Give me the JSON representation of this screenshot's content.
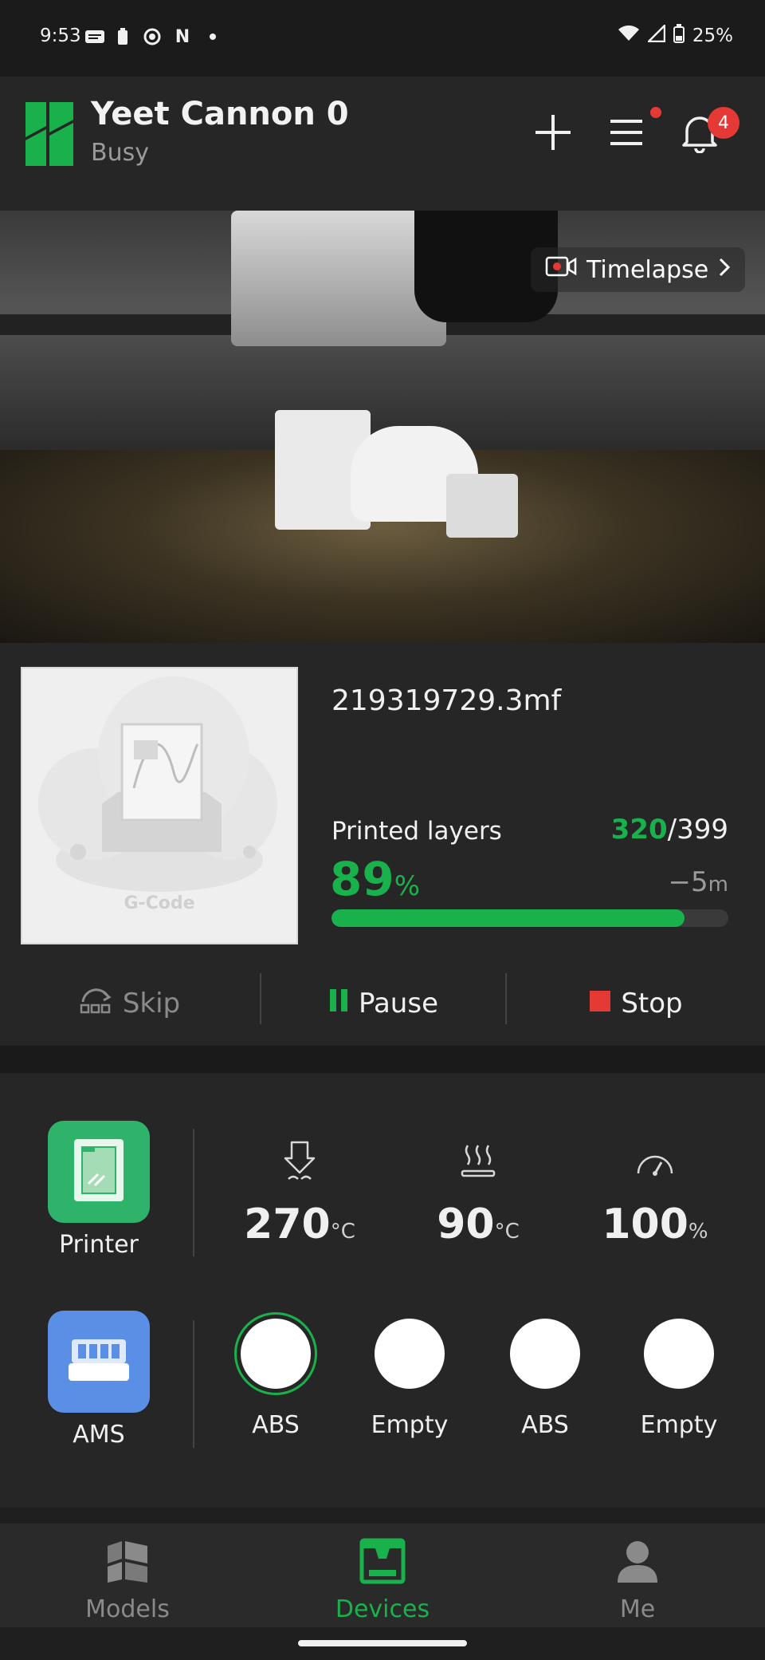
{
  "status_bar": {
    "time": "9:53",
    "battery": "25%"
  },
  "header": {
    "title": "Yeet Cannon 0",
    "subtitle": "Busy",
    "notification_count": "4"
  },
  "camera": {
    "timelapse_label": "Timelapse"
  },
  "print": {
    "filename": "219319729.3mf",
    "thumbnail_label": "G-Code",
    "layers_label": "Printed layers",
    "layers_current": "320",
    "layers_total": "/399",
    "progress_value": "89",
    "progress_unit": "%",
    "progress_fraction": 0.89,
    "remaining_value": "−5",
    "remaining_unit": "m",
    "controls": {
      "skip": "Skip",
      "pause": "Pause",
      "stop": "Stop"
    }
  },
  "device": {
    "printer_label": "Printer",
    "nozzle_temp": "270",
    "nozzle_unit": "°C",
    "bed_temp": "90",
    "bed_unit": "°C",
    "speed": "100",
    "speed_unit": "%",
    "ams_label": "AMS",
    "slots": [
      "ABS",
      "Empty",
      "ABS",
      "Empty"
    ]
  },
  "bottom_nav": {
    "models": "Models",
    "devices": "Devices",
    "me": "Me"
  },
  "colors": {
    "accent": "#19b14b",
    "danger": "#e53935",
    "ams_tile": "#5b8fe6",
    "printer_tile": "#2fb36a"
  },
  "icons": [
    "wifi-icon",
    "signal-icon",
    "battery-icon",
    "plus-icon",
    "menu-icon",
    "bell-icon",
    "camera-icon",
    "chevron-right-icon",
    "skip-icon",
    "pause-icon",
    "stop-icon",
    "nozzle-icon",
    "heatbed-icon",
    "speed-icon",
    "models-icon",
    "devices-icon",
    "me-icon"
  ]
}
